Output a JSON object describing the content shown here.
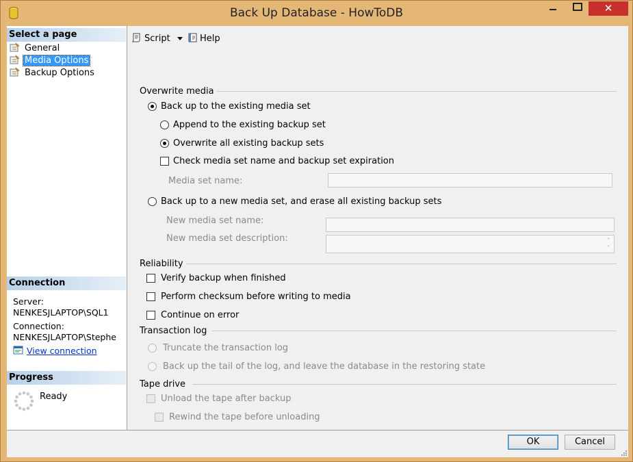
{
  "window": {
    "title": "Back Up Database - HowToDB"
  },
  "left_pane": {
    "select_header": "Select a page",
    "pages": [
      {
        "label": "General",
        "selected": false
      },
      {
        "label": "Media Options",
        "selected": true
      },
      {
        "label": "Backup Options",
        "selected": false
      }
    ],
    "connection_header": "Connection",
    "server_label": "Server:",
    "server_value": "NENKESJLAPTOP\\SQL1",
    "connection_label": "Connection:",
    "connection_value": "NENKESJLAPTOP\\Stephe",
    "view_connection": "View connection",
    "progress_header": "Progress",
    "progress_status": "Ready"
  },
  "toolbar": {
    "script_label": "Script",
    "help_label": "Help"
  },
  "overwrite_media": {
    "title": "Overwrite media",
    "existing_media_set": "Back up to the existing media set",
    "append": "Append to the existing backup set",
    "overwrite": "Overwrite all existing backup sets",
    "check_media": "Check media set name and backup set expiration",
    "media_set_name_label": "Media set name:",
    "media_set_name_value": "",
    "new_media_set": "Back up to a new media set, and erase all existing backup sets",
    "new_media_set_name_label": "New media set name:",
    "new_media_set_name_value": "",
    "new_media_set_desc_label": "New media set description:",
    "new_media_set_desc_value": ""
  },
  "reliability": {
    "title": "Reliability",
    "verify": "Verify backup when finished",
    "checksum": "Perform checksum before writing to media",
    "continue_on_error": "Continue on error"
  },
  "transaction_log": {
    "title": "Transaction log",
    "truncate": "Truncate the transaction log",
    "tail": "Back up the tail of the log, and leave the database in the restoring state"
  },
  "tape_drive": {
    "title": "Tape drive",
    "unload": "Unload the tape after backup",
    "rewind": "Rewind the tape before unloading"
  },
  "buttons": {
    "ok": "OK",
    "cancel": "Cancel"
  },
  "colors": {
    "title_bar": "#e4b777",
    "close_button": "#c7302b",
    "selection": "#3399ff",
    "link": "#0033cc",
    "pane_header": "#b8d0e8"
  }
}
